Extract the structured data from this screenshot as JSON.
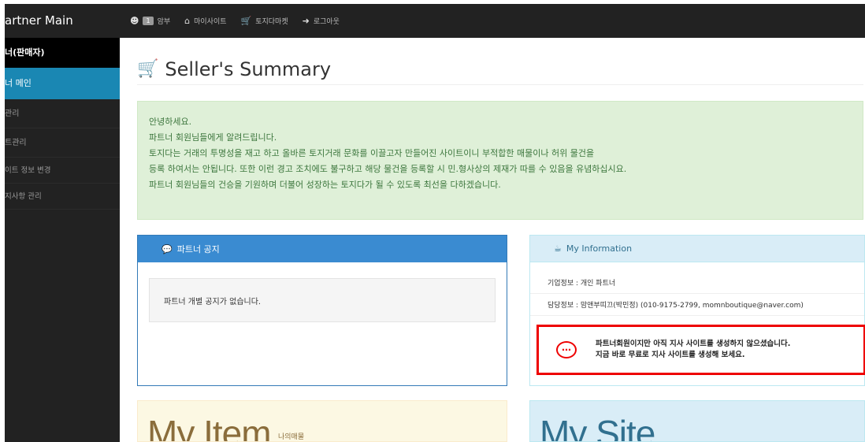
{
  "brand": {
    "title": "artner Main"
  },
  "topnav": {
    "badge": "1",
    "user_label": "암부",
    "mysite_label": "마이사이트",
    "market_label": "토지다마켓",
    "logout_label": "로그아웃"
  },
  "sidebar": {
    "header": "너(판매자)",
    "active": "너 메인",
    "items": [
      {
        "label": "관리"
      },
      {
        "label": "트관리"
      },
      {
        "label": "이트 정보 변경"
      },
      {
        "label": "지사항 관리"
      }
    ]
  },
  "page": {
    "title": "Seller's Summary"
  },
  "alert": {
    "lines": [
      "안녕하세요.",
      "파트너 회원님들에게 알려드립니다.",
      "토지다는 거래의 투명성을 재고 하고 올바른 토지거래 문화를 이끌고자 만들어진 사이트이니 부적합한 매물이나 허위 물건을",
      "등록 하여서는 안됩니다. 또한 이런 경고 조치에도 불구하고 해당 물건을 등록할 시 민.형사상의 제재가 따를 수 있음을 유념하십시요.",
      "파트너 회원님들의 건승을 기원하며 더불어 성장하는 토지다가 될 수 있도록 최선을 다하겠습니다."
    ]
  },
  "notice_panel": {
    "title": "파트너 공지",
    "empty": "파트너 개별 공지가 없습니다."
  },
  "info_panel": {
    "title": "My Information",
    "company": "기업정보 : 개인 파트너",
    "contact": "담당정보 : 맘앤부띠끄(박민정) (010-9175-2799, momnboutique@naver.com)",
    "warning_line1": "파트너회원이지만 아직 지사 사이트를 생성하지 않으셨습니다.",
    "warning_line2": "지금 바로 무료로 지사 사이트를 생성해 보세요."
  },
  "tiles": {
    "item_title": "My Item",
    "item_sub": "나의매물",
    "site_title": "My Site"
  },
  "colors": {
    "sidebar_active": "#1a87b3",
    "alert_bg": "#dff0d8",
    "notice_header": "#3a8bd1",
    "warning_border": "#ee0000"
  }
}
